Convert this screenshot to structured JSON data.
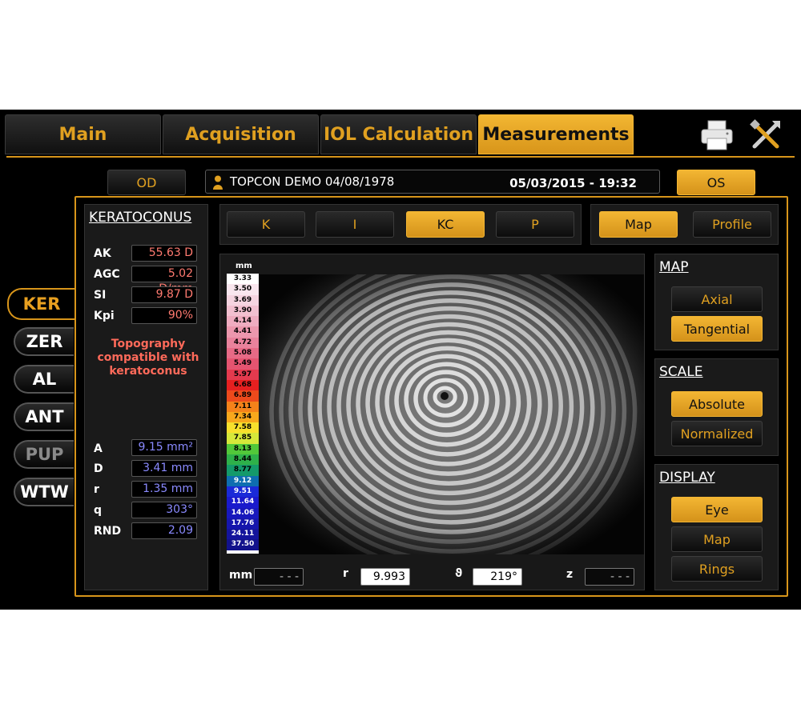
{
  "tabs": [
    {
      "label": "Main",
      "active": false
    },
    {
      "label": "Acquisition",
      "active": false
    },
    {
      "label": "IOL Calculation",
      "active": false
    },
    {
      "label": "Measurements",
      "active": true
    }
  ],
  "toolbar_icons": [
    "printer-icon",
    "tools-icon"
  ],
  "eye": {
    "od_label": "OD",
    "os_label": "OS",
    "selected": "OS"
  },
  "patient": {
    "name": "TOPCON DEMO 04/08/1978",
    "datetime": "05/03/2015 - 19:32"
  },
  "side_tabs": [
    {
      "label": "KER",
      "state": "active"
    },
    {
      "label": "ZER",
      "state": "normal"
    },
    {
      "label": "AL",
      "state": "normal"
    },
    {
      "label": "ANT",
      "state": "normal"
    },
    {
      "label": "PUP",
      "state": "disabled"
    },
    {
      "label": "WTW",
      "state": "normal"
    }
  ],
  "keratoconus": {
    "title": "KERATOCONUS",
    "indices": [
      {
        "label": "AK",
        "value": "55.63 D"
      },
      {
        "label": "AGC",
        "value": "5.02 D/mm"
      },
      {
        "label": "SI",
        "value": "9.87 D"
      },
      {
        "label": "Kpi",
        "value": "90%"
      }
    ],
    "message": "Topography compatible with keratoconus",
    "zone": [
      {
        "label": "A",
        "value": "9.15 mm²"
      },
      {
        "label": "D",
        "value": "3.41 mm"
      },
      {
        "label": "r",
        "value": "1.35 mm"
      },
      {
        "label": "q",
        "value": "303°"
      },
      {
        "label": "RND",
        "value": "2.09"
      }
    ]
  },
  "mode_buttons": [
    {
      "label": "K",
      "active": false
    },
    {
      "label": "I",
      "active": false
    },
    {
      "label": "KC",
      "active": true
    },
    {
      "label": "P",
      "active": false
    }
  ],
  "view_buttons": [
    {
      "label": "Map",
      "active": true
    },
    {
      "label": "Profile",
      "active": false
    }
  ],
  "color_scale": {
    "unit": "mm",
    "values": [
      "3.33",
      "3.50",
      "3.69",
      "3.90",
      "4.14",
      "4.41",
      "4.72",
      "5.08",
      "5.49",
      "5.97",
      "6.68",
      "6.89",
      "7.11",
      "7.34",
      "7.58",
      "7.85",
      "8.13",
      "8.44",
      "8.77",
      "9.12",
      "9.51",
      "11.64",
      "14.06",
      "17.76",
      "24.11",
      "37.50"
    ],
    "colors": [
      "#ffffff",
      "#f9e6ee",
      "#f5d4e0",
      "#f2c0d0",
      "#efacc0",
      "#ec97ad",
      "#e9829c",
      "#e76a86",
      "#e55470",
      "#e43a4e",
      "#e62020",
      "#ed4a1c",
      "#f5821a",
      "#f8a81c",
      "#f8e02c",
      "#d6e83a",
      "#52c83a",
      "#2eb04a",
      "#149a6a",
      "#0e6eb0",
      "#1a2ad8",
      "#1a1acc",
      "#1818bc",
      "#1616ac",
      "#14149c",
      "#12128c"
    ]
  },
  "coords": [
    {
      "label": "mm",
      "value": "- - -",
      "style": "dark"
    },
    {
      "label": "r",
      "value": "9.993",
      "style": "light"
    },
    {
      "label": "ϑ",
      "value": "219°",
      "style": "light"
    },
    {
      "label": "z",
      "value": "- - -",
      "style": "dark"
    }
  ],
  "map_section": {
    "title": "MAP",
    "options": [
      {
        "label": "Axial",
        "active": false
      },
      {
        "label": "Tangential",
        "active": true
      }
    ]
  },
  "scale_section": {
    "title": "SCALE",
    "options": [
      {
        "label": "Absolute",
        "active": true
      },
      {
        "label": "Normalized",
        "active": false
      }
    ]
  },
  "display_section": {
    "title": "DISPLAY",
    "options": [
      {
        "label": "Eye",
        "active": true
      },
      {
        "label": "Map",
        "active": false
      },
      {
        "label": "Rings",
        "active": false
      }
    ]
  }
}
